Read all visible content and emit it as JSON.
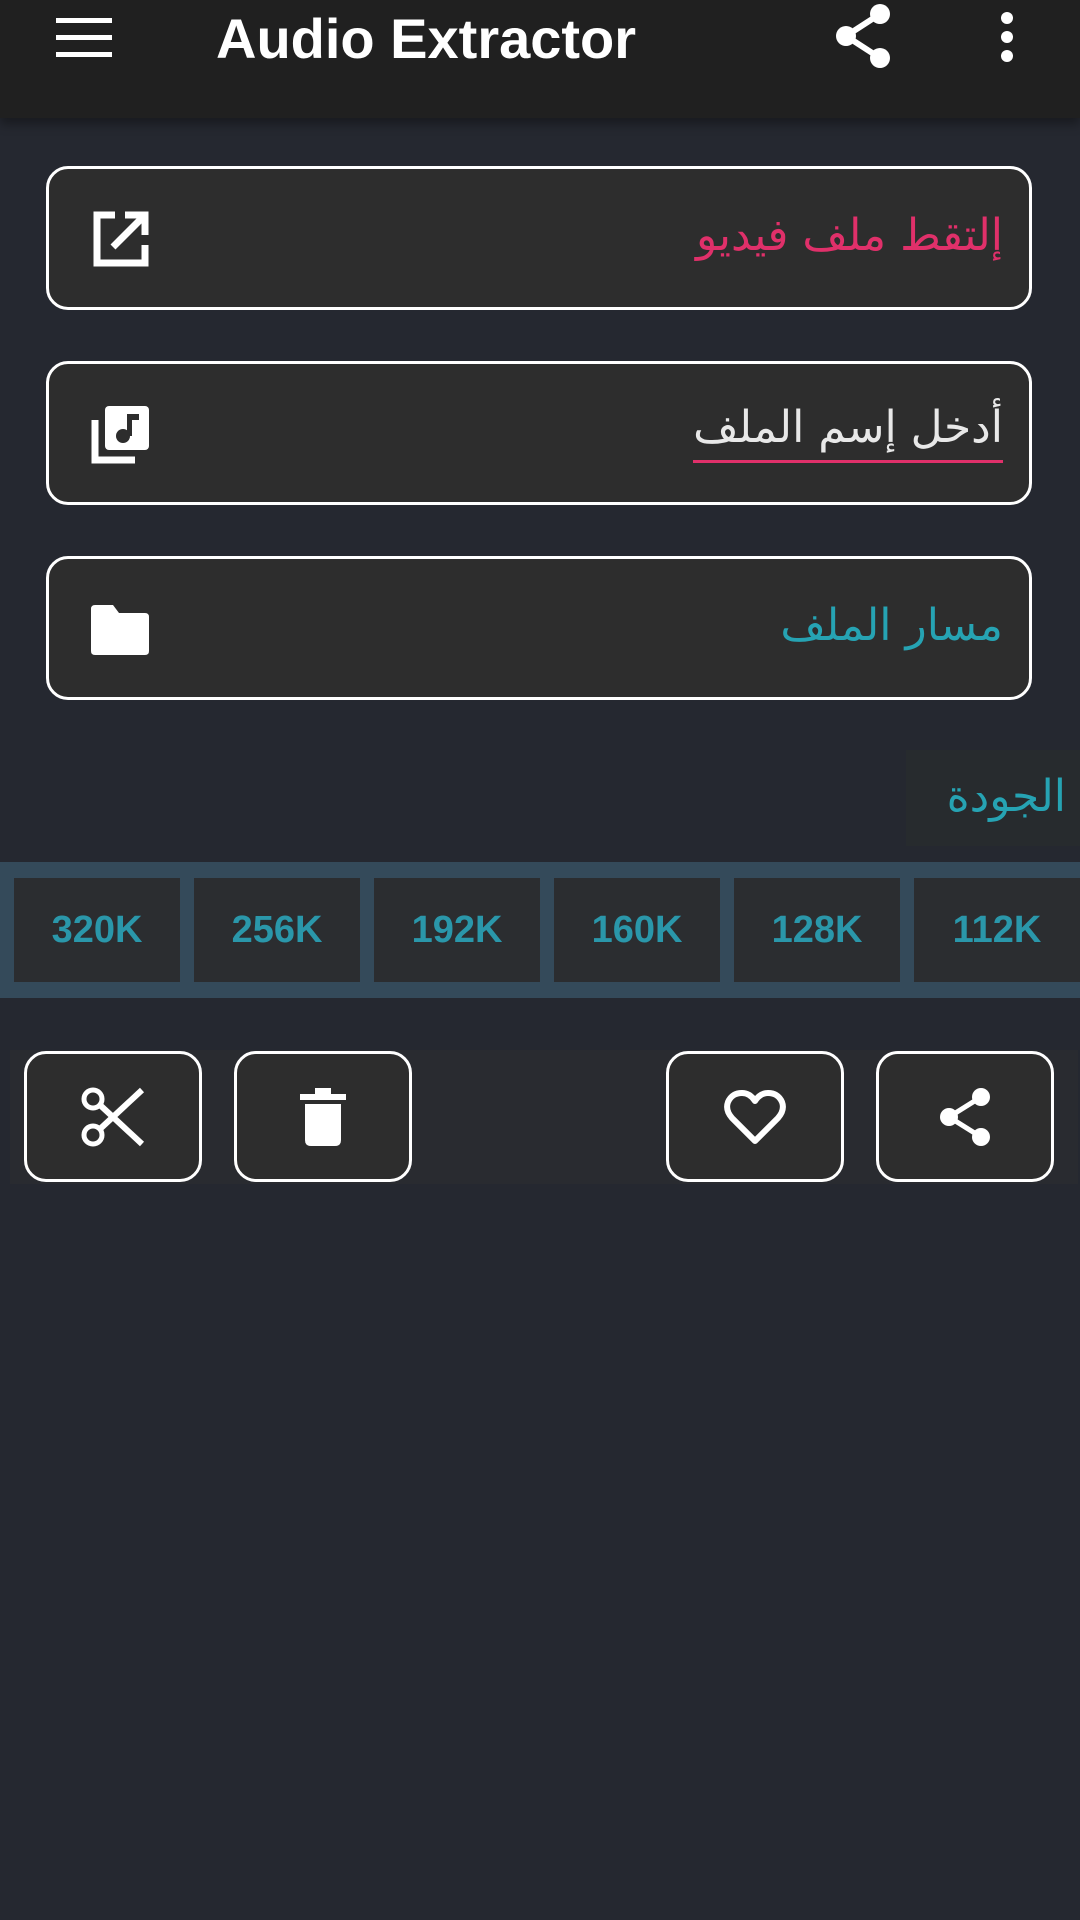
{
  "app": {
    "title": "Audio Extractor"
  },
  "icons": {
    "menu": "menu-icon",
    "share": "share-icon",
    "more": "more-vert-icon",
    "pick": "open-in-new-icon",
    "filename": "library-music-icon",
    "path": "folder-icon",
    "cut": "scissors-icon",
    "delete": "trash-icon",
    "favorite": "heart-icon"
  },
  "form": {
    "pick_video": "إلتقط ملف فيديو",
    "file_name_placeholder": "أدخل إسم الملف",
    "file_path": "مسار الملف"
  },
  "quality": {
    "label": "الجودة",
    "options": [
      "320K",
      "256K",
      "192K",
      "160K",
      "128K",
      "112K"
    ]
  },
  "colors": {
    "background": "#252830",
    "appbar": "#202020",
    "accent_pink": "#e0306a",
    "accent_teal": "#26a3b3",
    "bitrate_bar": "#344a5a"
  }
}
